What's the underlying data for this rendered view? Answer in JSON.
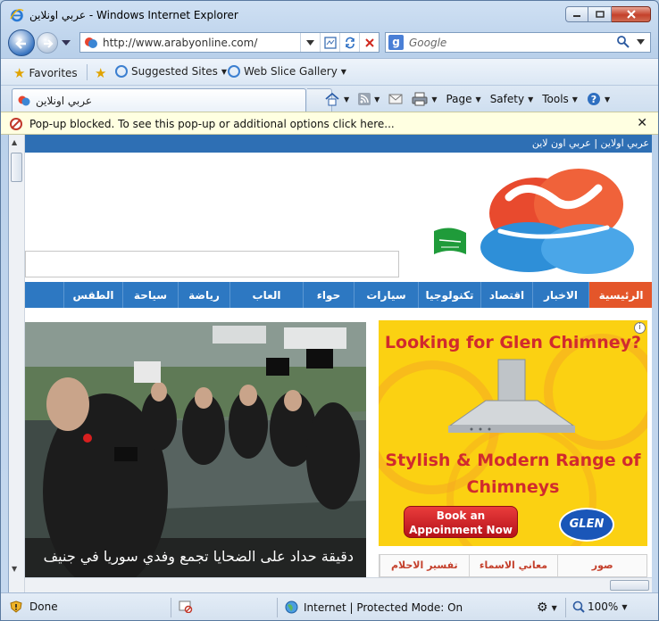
{
  "window": {
    "title": "عربي اونلاين - Windows Internet Explorer"
  },
  "address": {
    "url": "http://www.arabyonline.com/",
    "search_placeholder": "Google"
  },
  "favorites_bar": {
    "favorites_label": "Favorites",
    "suggested_label": "Suggested Sites",
    "slice_label": "Web Slice Gallery"
  },
  "tab": {
    "title": "عربي اونلاين"
  },
  "command_bar": {
    "page": "Page",
    "safety": "Safety",
    "tools": "Tools"
  },
  "popup": {
    "message": "Pop-up blocked. To see this pop-up or additional options click here..."
  },
  "site": {
    "top_links": "عربي اولاين | عربي اون لاين",
    "nav": [
      "الرئيسية",
      "الاخبار",
      "اقتصاد",
      "تكنولوجيا",
      "سيارات",
      "حواء",
      "العاب",
      "رياضة",
      "سياحة",
      "الطقس"
    ],
    "photo_caption": "دقيقة حداد على الضحايا تجمع وفدي سوريا في جنيف",
    "ad": {
      "headline": "Looking for Glen Chimney?",
      "subline_1": "Stylish & Modern Range of",
      "subline_2": "Chimneys",
      "cta_1": "Book an",
      "cta_2": "Appoinment Now",
      "brand": "GLEN"
    },
    "subtabs": [
      "صور",
      "معاني الاسماء",
      "تفسير الاحلام"
    ]
  },
  "status_bar": {
    "left": "Done",
    "zone": "Internet | Protected Mode: On",
    "zoom": "100%"
  },
  "colors": {
    "nav_bg": "#2d78c2",
    "nav_active": "#e4562a",
    "ad_bg": "#fbd112",
    "ad_text": "#d12a2e"
  }
}
